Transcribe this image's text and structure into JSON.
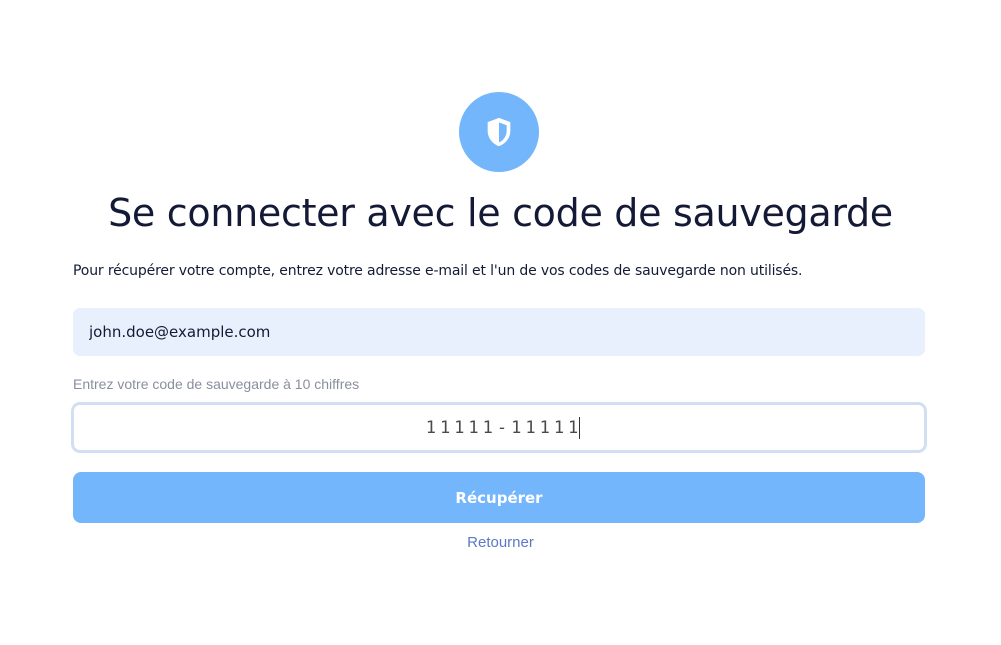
{
  "header": {
    "icon": "shield-icon",
    "title": "Se connecter avec le code de sauvegarde",
    "description": "Pour récupérer votre compte, entrez votre adresse e-mail et l'un de vos codes de sauvegarde non utilisés."
  },
  "form": {
    "email_value": "john.doe@example.com",
    "code_label": "Entrez votre code de sauvegarde à 10 chiffres",
    "code_value": "11111-11111",
    "submit_label": "Récupérer",
    "back_label": "Retourner"
  },
  "colors": {
    "accent": "#74b6fb",
    "title_text": "#141a35",
    "email_bg": "#e9f0fd",
    "code_border": "#d2dff3",
    "link": "#5b79c6",
    "muted_label": "#8a8f9e"
  }
}
